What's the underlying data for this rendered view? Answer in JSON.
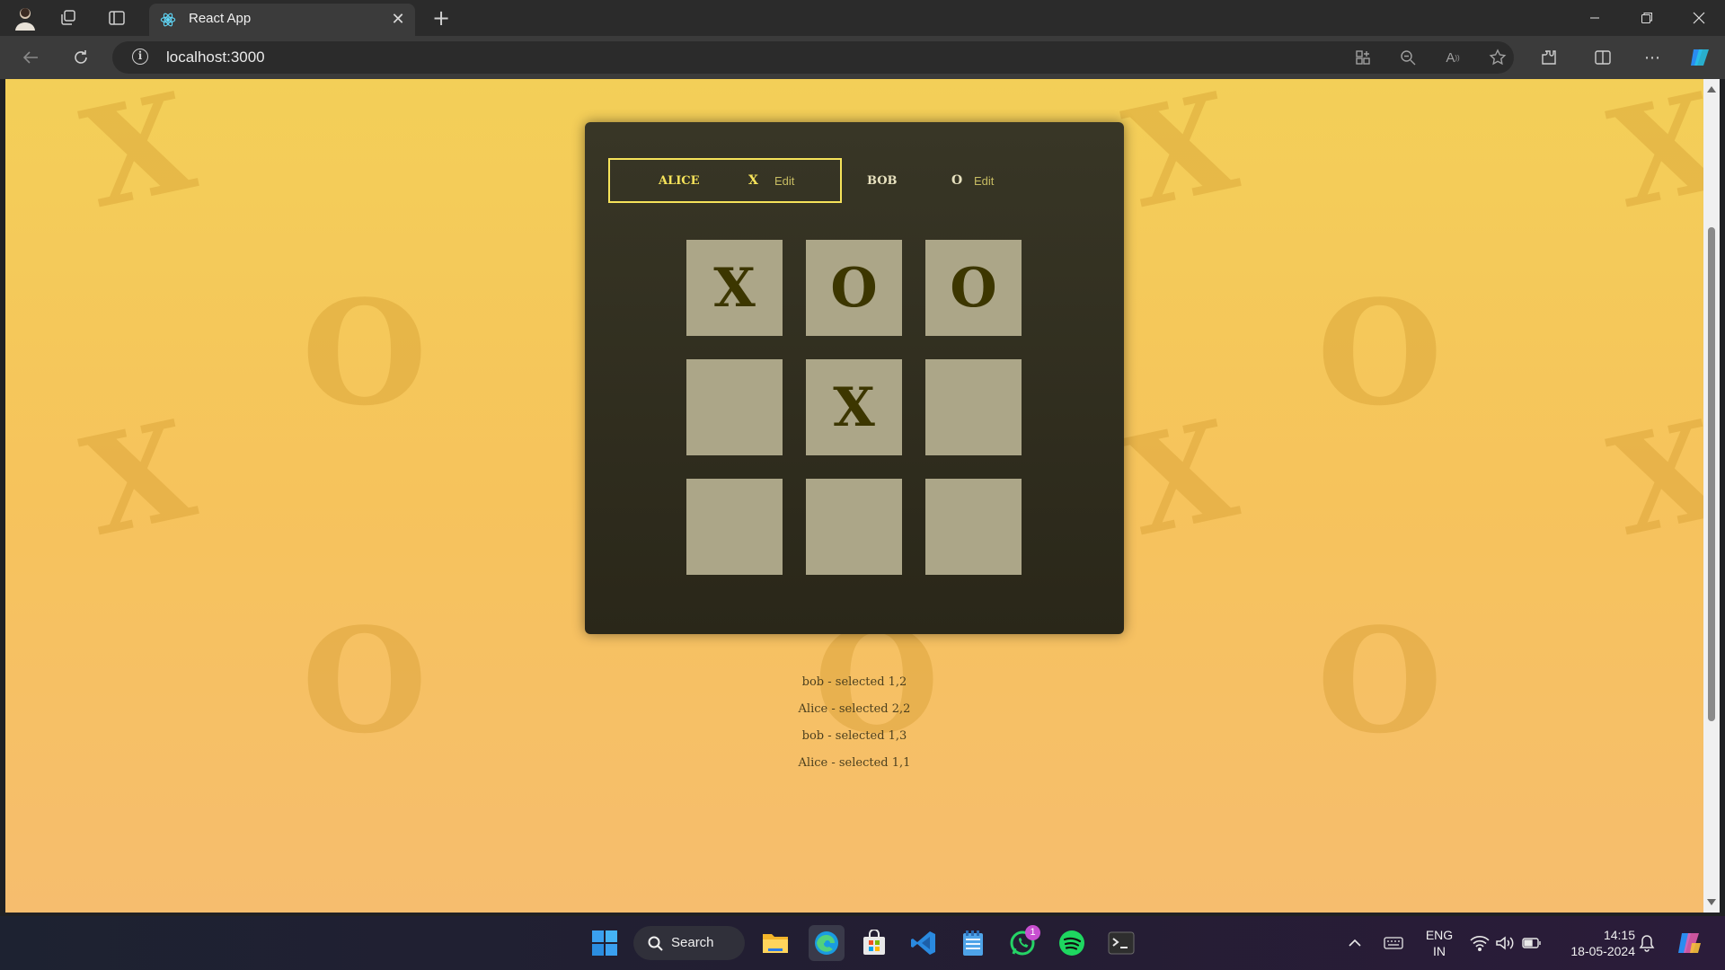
{
  "browser": {
    "tab_title": "React App",
    "url": "localhost:3000"
  },
  "game": {
    "players": [
      {
        "name": "ALICE",
        "symbol": "X",
        "edit_label": "Edit",
        "active": true
      },
      {
        "name": "BOB",
        "symbol": "O",
        "edit_label": "Edit",
        "active": false
      }
    ],
    "board": [
      [
        "X",
        "O",
        "O"
      ],
      [
        "",
        "X",
        ""
      ],
      [
        "",
        "",
        ""
      ]
    ],
    "log": [
      "bob - selected 1,2",
      "Alice - selected 2,2",
      "bob - selected 1,3",
      "Alice - selected 1,1"
    ],
    "colors": {
      "accent": "#f6e35a",
      "cell": "#aca688",
      "panel": "#2f2c1f",
      "background": "#f6c35c"
    }
  },
  "taskbar": {
    "search_label": "Search",
    "whatsapp_badge": "1",
    "language": "ENG",
    "region": "IN",
    "time": "14:15",
    "date": "18-05-2024"
  }
}
